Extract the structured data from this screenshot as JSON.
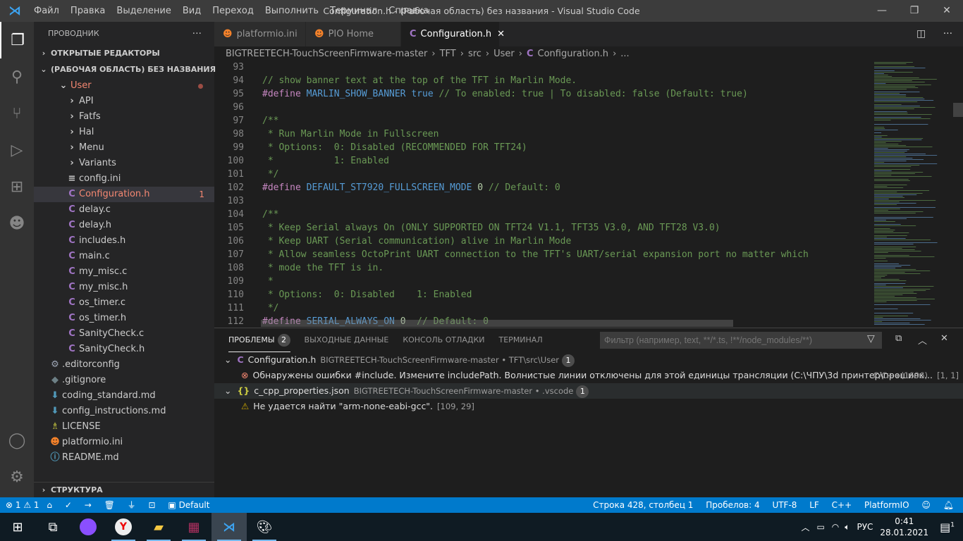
{
  "titlebar": {
    "menu": [
      "Файл",
      "Правка",
      "Выделение",
      "Вид",
      "Переход",
      "Выполнить",
      "Терминал",
      "Справка"
    ],
    "title": "Configuration.h - (Рабочая область) без названия - Visual Studio Code"
  },
  "activity": [
    "files-icon",
    "search-icon",
    "source-control-icon",
    "run-debug-icon",
    "extensions-icon",
    "platformio-icon"
  ],
  "sidebar": {
    "title": "ПРОВОДНИК",
    "more": "···",
    "open_editors": "ОТКРЫТЫЕ РЕДАКТОРЫ",
    "workspace": "(РАБОЧАЯ ОБЛАСТЬ) БЕЗ НАЗВАНИЯ",
    "outline": "СТРУКТУРА",
    "items": [
      {
        "label": "User",
        "type": "folder-open",
        "depth": 1,
        "color": "#f48771",
        "dot": true
      },
      {
        "label": "API",
        "type": "folder",
        "depth": 2
      },
      {
        "label": "Fatfs",
        "type": "folder",
        "depth": 2
      },
      {
        "label": "Hal",
        "type": "folder",
        "depth": 2
      },
      {
        "label": "Menu",
        "type": "folder",
        "depth": 2
      },
      {
        "label": "Variants",
        "type": "folder",
        "depth": 2
      },
      {
        "label": "config.ini",
        "type": "ini",
        "depth": 2
      },
      {
        "label": "Configuration.h",
        "type": "c",
        "depth": 2,
        "color": "#f48771",
        "badge": "1",
        "selected": true
      },
      {
        "label": "delay.c",
        "type": "c",
        "depth": 2
      },
      {
        "label": "delay.h",
        "type": "c",
        "depth": 2
      },
      {
        "label": "includes.h",
        "type": "c",
        "depth": 2
      },
      {
        "label": "main.c",
        "type": "c",
        "depth": 2
      },
      {
        "label": "my_misc.c",
        "type": "c",
        "depth": 2
      },
      {
        "label": "my_misc.h",
        "type": "c",
        "depth": 2
      },
      {
        "label": "os_timer.c",
        "type": "c",
        "depth": 2
      },
      {
        "label": "os_timer.h",
        "type": "c",
        "depth": 2
      },
      {
        "label": "SanityCheck.c",
        "type": "c",
        "depth": 2
      },
      {
        "label": "SanityCheck.h",
        "type": "c",
        "depth": 2
      },
      {
        "label": ".editorconfig",
        "type": "gear",
        "depth": 0
      },
      {
        "label": ".gitignore",
        "type": "git",
        "depth": 0
      },
      {
        "label": "coding_standard.md",
        "type": "md",
        "depth": 0
      },
      {
        "label": "config_instructions.md",
        "type": "md",
        "depth": 0
      },
      {
        "label": "LICENSE",
        "type": "license",
        "depth": 0
      },
      {
        "label": "platformio.ini",
        "type": "pio",
        "depth": 0
      },
      {
        "label": "README.md",
        "type": "info",
        "depth": 0
      }
    ]
  },
  "tabs": [
    {
      "label": "platformio.ini",
      "icon": "pio"
    },
    {
      "label": "PIO Home",
      "icon": "pio"
    },
    {
      "label": "Configuration.h",
      "icon": "c",
      "active": true
    }
  ],
  "breadcrumb": [
    "BIGTREETECH-TouchScreenFirmware-master",
    "TFT",
    "src",
    "User",
    "Configuration.h",
    "..."
  ],
  "code": [
    {
      "n": "93",
      "s": []
    },
    {
      "n": "94",
      "s": [
        [
          "cm",
          "// show banner text at the top of the TFT in Marlin Mode."
        ]
      ]
    },
    {
      "n": "95",
      "s": [
        [
          "pp",
          "#define "
        ],
        [
          "mc",
          "MARLIN_SHOW_BANNER "
        ],
        [
          "kw",
          "true "
        ],
        [
          "cm",
          "// To enabled: true | To disabled: false (Default: true)"
        ]
      ]
    },
    {
      "n": "96",
      "s": []
    },
    {
      "n": "97",
      "s": [
        [
          "cm",
          "/**"
        ]
      ]
    },
    {
      "n": "98",
      "s": [
        [
          "cm",
          " * Run Marlin Mode in Fullscreen"
        ]
      ]
    },
    {
      "n": "99",
      "s": [
        [
          "cm",
          " * Options:  0: Disabled (RECOMMENDED FOR TFT24)"
        ]
      ]
    },
    {
      "n": "100",
      "s": [
        [
          "cm",
          " *           1: Enabled"
        ]
      ]
    },
    {
      "n": "101",
      "s": [
        [
          "cm",
          " */"
        ]
      ]
    },
    {
      "n": "102",
      "s": [
        [
          "pp",
          "#define "
        ],
        [
          "mc",
          "DEFAULT_ST7920_FULLSCREEN_MODE "
        ],
        [
          "nu",
          "0 "
        ],
        [
          "cm",
          "// Default: 0"
        ]
      ]
    },
    {
      "n": "103",
      "s": []
    },
    {
      "n": "104",
      "s": [
        [
          "cm",
          "/**"
        ]
      ]
    },
    {
      "n": "105",
      "s": [
        [
          "cm",
          " * Keep Serial always On (ONLY SUPPORTED ON TFT24 V1.1, TFT35 V3.0, AND TFT28 V3.0)"
        ]
      ]
    },
    {
      "n": "106",
      "s": [
        [
          "cm",
          " * Keep UART (Serial communication) alive in Marlin Mode"
        ]
      ]
    },
    {
      "n": "107",
      "s": [
        [
          "cm",
          " * Allow seamless OctoPrint UART connection to the TFT's UART/serial expansion port no matter which"
        ]
      ]
    },
    {
      "n": "108",
      "s": [
        [
          "cm",
          " * mode the TFT is in."
        ]
      ]
    },
    {
      "n": "109",
      "s": [
        [
          "cm",
          " *"
        ]
      ]
    },
    {
      "n": "110",
      "s": [
        [
          "cm",
          " * Options:  0: Disabled    1: Enabled"
        ]
      ]
    },
    {
      "n": "111",
      "s": [
        [
          "cm",
          " */"
        ]
      ]
    },
    {
      "n": "112",
      "s": [
        [
          "pp",
          "#define "
        ],
        [
          "mc",
          "SERIAL_ALWAYS_ON "
        ],
        [
          "nu",
          "0  "
        ],
        [
          "cm",
          "// Default: 0"
        ]
      ]
    }
  ],
  "panel": {
    "tabs": [
      {
        "label": "ПРОБЛЕМЫ",
        "badge": "2",
        "active": true
      },
      {
        "label": "ВЫХОДНЫЕ ДАННЫЕ"
      },
      {
        "label": "КОНСОЛЬ ОТЛАДКИ"
      },
      {
        "label": "ТЕРМИНАЛ"
      }
    ],
    "filter_placeholder": "Фильтр (например, text, **/*.ts, !**/node_modules/**)",
    "groups": [
      {
        "file": "Configuration.h",
        "path": "BIGTREETECH-TouchScreenFirmware-master • TFT\\src\\User",
        "count": "1",
        "icon": "c",
        "items": [
          {
            "severity": "error",
            "message": "Обнаружены ошибки #include. Измените includePath. Волнистые линии отключены для этой единицы трансляции (C:\\ЧПУ\\3d принтер\\прошивк...",
            "source": "C/C++(1696)",
            "pos": "[1, 1]"
          }
        ]
      },
      {
        "file": "c_cpp_properties.json",
        "path": "BIGTREETECH-TouchScreenFirmware-master • .vscode",
        "count": "1",
        "icon": "json",
        "items": [
          {
            "severity": "warning",
            "message": "Не удается найти \"arm-none-eabi-gcc\".",
            "source": "",
            "pos": "[109, 29]"
          }
        ]
      }
    ]
  },
  "status": {
    "errors": "1",
    "warnings": "1",
    "profile": "Default",
    "position": "Строка 428, столбец 1",
    "spaces": "Пробелов: 4",
    "encoding": "UTF-8",
    "eol": "LF",
    "lang": "C++",
    "platform": "PlatformIO"
  },
  "taskbar": {
    "time": "0:41",
    "date": "28.01.2021",
    "lang": "РУС",
    "notif": "1"
  },
  "colors": {
    "accent": "#007acc",
    "error": "#f48771",
    "warning": "#cca700"
  }
}
